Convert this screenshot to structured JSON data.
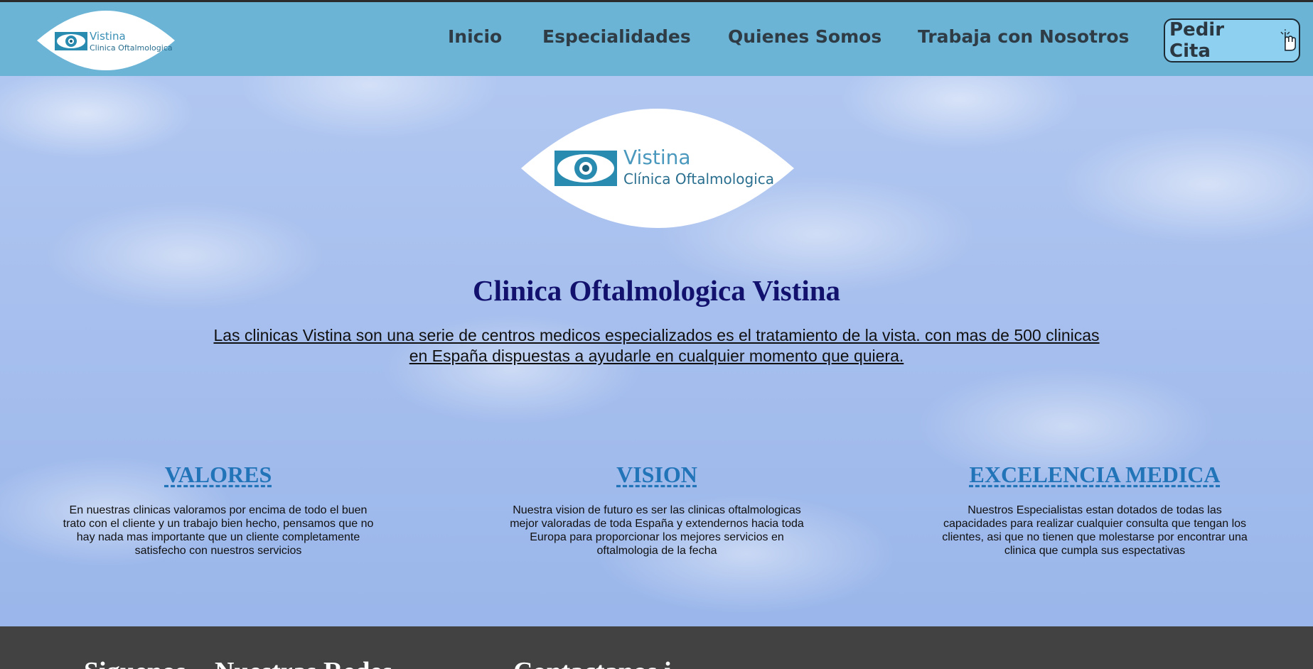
{
  "brand": {
    "name": "Vistina",
    "subtitle": "Clinica Oftalmologica"
  },
  "nav": {
    "items": [
      "Inicio",
      "Especialidades",
      "Quienes Somos",
      "Trabaja con Nosotros"
    ],
    "cta_label": "Pedir Cita"
  },
  "hero": {
    "logo_name": "Vistina",
    "logo_subtitle": "Clínica Oftalmologica",
    "title": "Clinica Oftalmologica Vistina",
    "intro": "Las clinicas Vistina son una serie de centros medicos especializados es el tratamiento de la vista. con mas de 500 clinicas en España dispuestas a ayudarle en cualquier momento que quiera."
  },
  "columns": [
    {
      "heading": "VALORES",
      "text": "En nuestras clinicas valoramos por encima de todo el buen trato con el cliente y un trabajo bien hecho, pensamos que no hay nada mas importante que un cliente completamente satisfecho con nuestros servicios"
    },
    {
      "heading": "VISION",
      "text": "Nuestra vision de futuro es ser las clinicas oftalmologicas mejor valoradas de toda España y extendernos hacia toda Europa para proporcionar los mejores servicios en oftalmologia de la fecha"
    },
    {
      "heading": "EXCELENCIA MEDICA",
      "text": "Nuestros Especialistas estan dotados de todas las capacidades para realizar cualquier consulta que tengan los clientes, asi que no tienen que molestarse por encontrar una clinica que cumpla sus espectativas"
    }
  ],
  "footer": {
    "headings": [
      "Siguenos",
      "Nuestras Redes",
      "Contactanos i"
    ]
  },
  "colors": {
    "header_bg": "#6bb4d6",
    "cta_bg": "#8ed0f0",
    "title": "#12126e",
    "column_heading": "#2274b8",
    "footer_bg": "#424242"
  },
  "icons": [
    "eye-logo-icon",
    "pointer-hand-icon"
  ]
}
